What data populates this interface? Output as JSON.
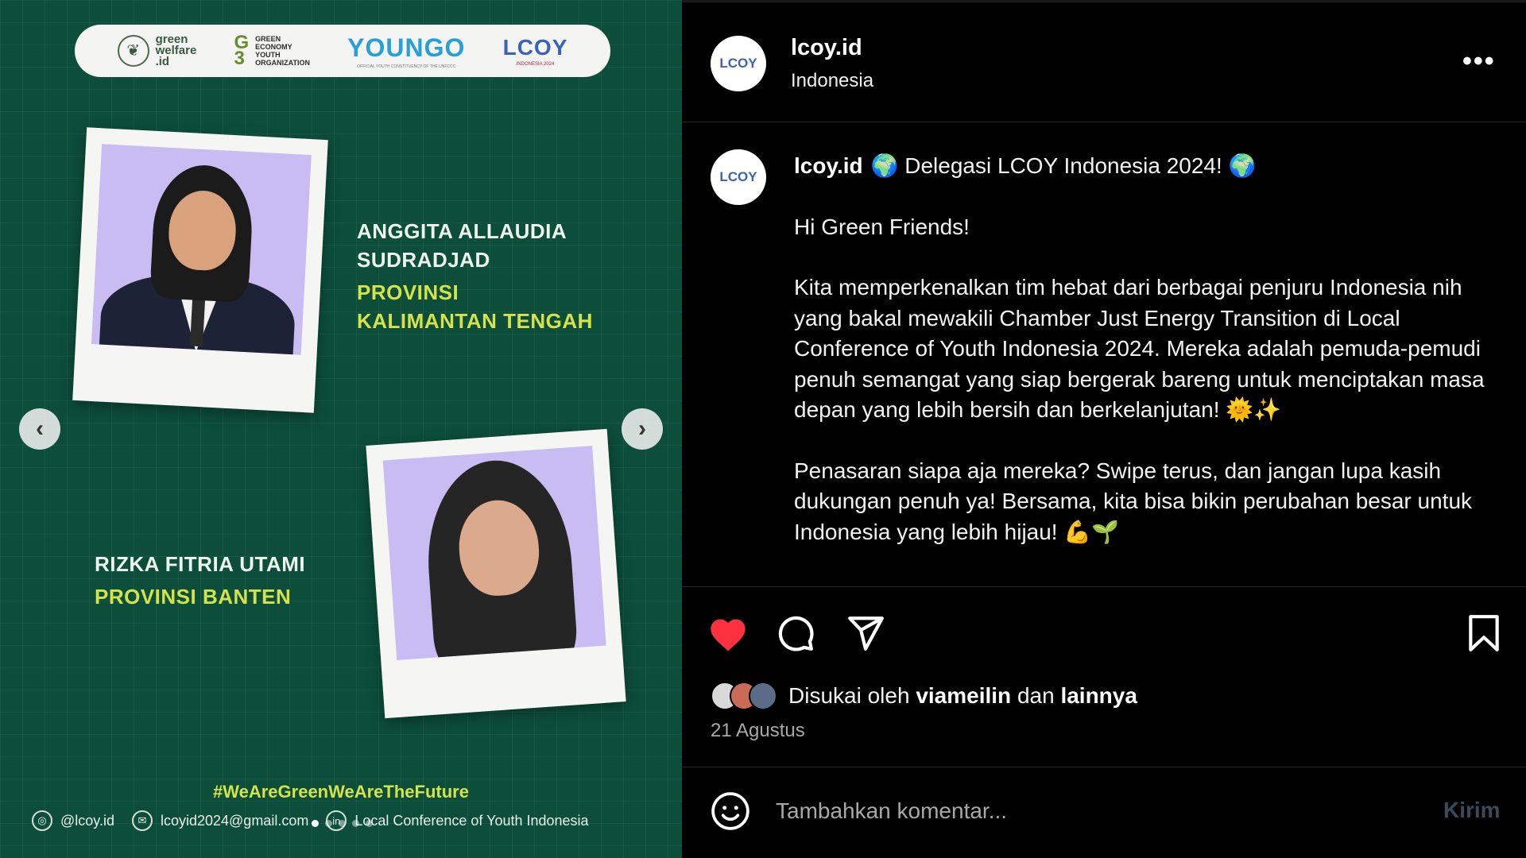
{
  "slide": {
    "logos": {
      "green_welfare": "green\nwelfare\n.id",
      "green_economy_mark": "G\n3",
      "green_economy_text": "GREEN\nECONOMY\nYOUTH\nORGANIZATION",
      "youngo": "YOUNGO",
      "youngo_sub": "OFFICIAL YOUTH CONSTITUENCY OF THE UNFCCC",
      "lcoy": "LCOY",
      "lcoy_sub": "INDONESIA 2024"
    },
    "person1": {
      "name": "ANGGITA ALLAUDIA\nSUDRADJAD",
      "province": "PROVINSI\nKALIMANTAN TENGAH"
    },
    "person2": {
      "name": "RIZKA FITRIA UTAMI",
      "province": "PROVINSI BANTEN"
    },
    "nav": {
      "prev": "‹",
      "next": "›"
    },
    "hashtag": "#WeAreGreenWeAreTheFuture",
    "footer": {
      "instagram": "@lcoy.id",
      "email": "lcoyid2024@gmail.com",
      "linkedin": "Local Conference of Youth Indonesia"
    }
  },
  "post": {
    "account": "lcoy.id",
    "avatar_text": "LCOY",
    "location": "Indonesia",
    "more": "•••",
    "caption": {
      "username": "lcoy.id",
      "first_line": "🌍 Delegasi LCOY Indonesia 2024! 🌍",
      "greeting": "Hi Green Friends!",
      "paragraph1": "Kita memperkenalkan tim hebat dari berbagai penjuru Indonesia nih yang bakal mewakili Chamber Just Energy Transition di Local Conference of Youth Indonesia 2024. Mereka adalah pemuda-pemudi penuh semangat yang siap bergerak bareng untuk menciptakan masa depan yang lebih bersih dan berkelanjutan! 🌞✨",
      "paragraph2": "Penasaran siapa aja mereka? Swipe terus, dan jangan lupa kasih dukungan penuh ya! Bersama, kita bisa bikin perubahan besar untuk Indonesia yang lebih hijau! 💪🌱"
    },
    "likes": {
      "prefix": "Disukai oleh",
      "user": "viameilin",
      "joiner": "dan",
      "others": "lainnya"
    },
    "date": "21 Agustus",
    "comment": {
      "placeholder": "Tambahkan komentar...",
      "post_label": "Kirim"
    },
    "colors": {
      "like_red": "#ff3040",
      "background": "#000000",
      "slide_green": "#0c4e3a",
      "accent_yellow": "#d4e34a"
    }
  }
}
